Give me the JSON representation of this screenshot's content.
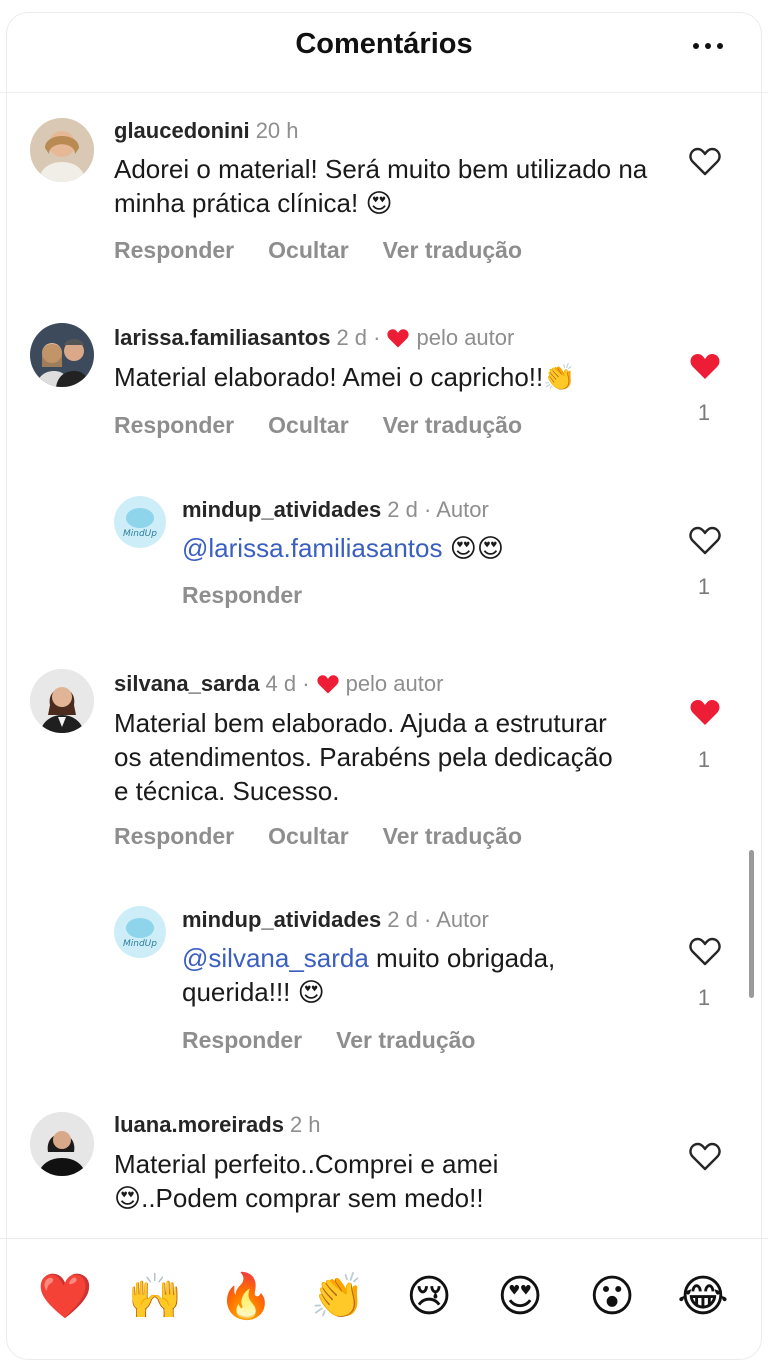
{
  "header": {
    "title": "Comentários"
  },
  "comments": [
    {
      "user": "glaucedonini",
      "time": "20 h",
      "text": "Adorei o material! Será muito bem utilizado na minha prática clínica! 😍",
      "actions": [
        "Responder",
        "Ocultar",
        "Ver tradução"
      ],
      "liked": false,
      "likes": ""
    },
    {
      "user": "larissa.familiasantos",
      "time": "2 d ·",
      "badge": "pelo autor",
      "text": "Material elaborado! Amei o capricho!!👏",
      "actions": [
        "Responder",
        "Ocultar",
        "Ver tradução"
      ],
      "liked": true,
      "likes": "1"
    },
    {
      "user": "mindup_atividades",
      "time": "2 d · Autor",
      "mention": "@larissa.familiasantos",
      "text": " 😍😍",
      "actions": [
        "Responder"
      ],
      "liked": false,
      "likes": "1"
    },
    {
      "user": "silvana_sarda",
      "time": "4 d ·",
      "badge": "pelo autor",
      "text": "Material bem elaborado. Ajuda a estruturar os atendimentos. Parabéns pela dedicação e técnica. Sucesso.",
      "actions": [
        "Responder",
        "Ocultar",
        "Ver tradução"
      ],
      "liked": true,
      "likes": "1"
    },
    {
      "user": "mindup_atividades",
      "time": "2 d · Autor",
      "mention": "@silvana_sarda",
      "text": " muito obrigada, querida!!! 😍",
      "actions": [
        "Responder",
        "Ver tradução"
      ],
      "liked": false,
      "likes": "1"
    },
    {
      "user": "luana.moreirads",
      "time": "2 h",
      "text": "Material perfeito..Comprei e amei 😍..Podem comprar sem medo!!",
      "actions": [],
      "liked": false,
      "likes": ""
    }
  ],
  "reactions": [
    "❤️",
    "🙌",
    "🔥",
    "👏",
    "😢",
    "😍",
    "😮",
    "😂"
  ],
  "icons": {
    "more": "more-horizontal-icon",
    "heart": "heart-icon",
    "avatar_brand": "MindUp"
  },
  "colors": {
    "liked": "#ee1d36",
    "mention": "#3b5fc0",
    "muted": "#8e8e8e"
  }
}
